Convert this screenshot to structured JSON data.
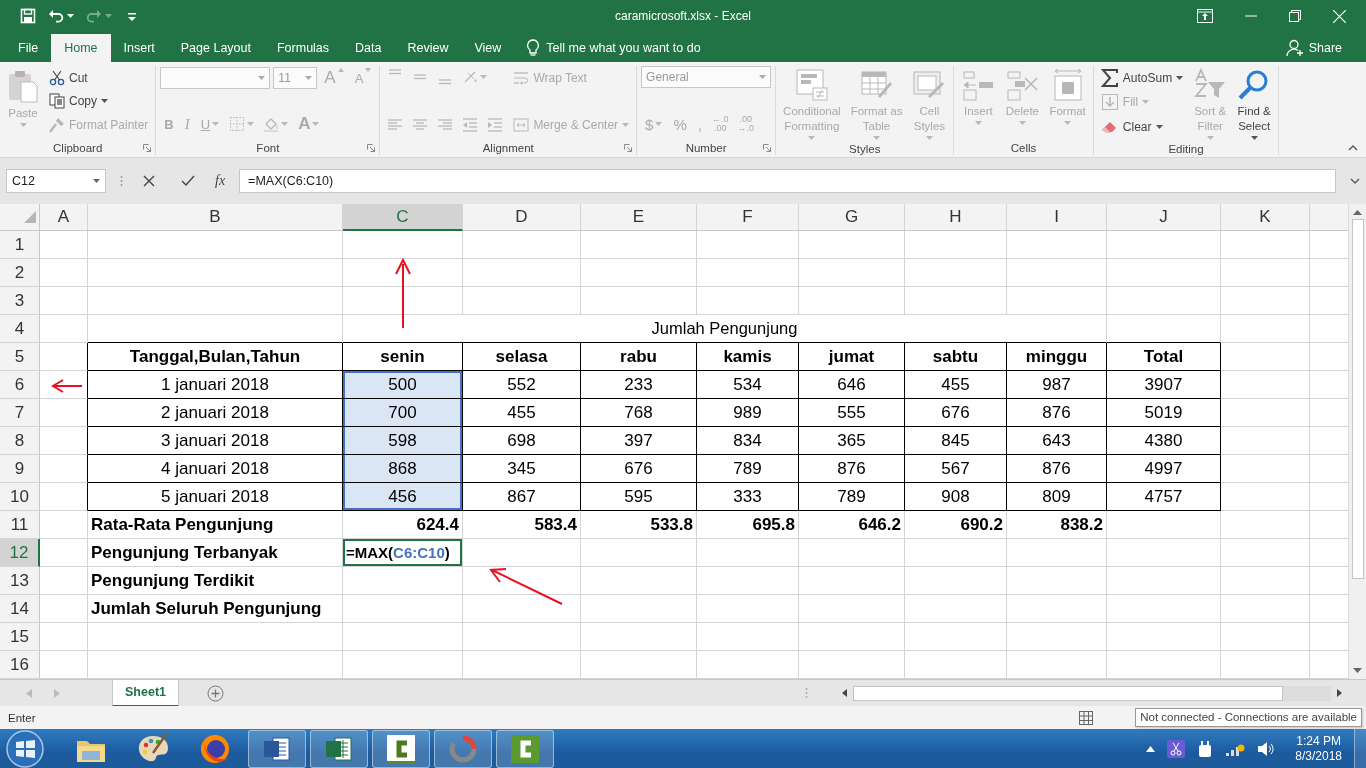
{
  "window": {
    "title": "caramicrosoft.xlsx - Excel"
  },
  "quick_access": [
    {
      "kind": "save",
      "disabled": false,
      "dropdown": false
    },
    {
      "kind": "undo",
      "disabled": false,
      "dropdown": true
    },
    {
      "kind": "redo",
      "disabled": true,
      "dropdown": true
    },
    {
      "kind": "customize",
      "disabled": false,
      "dropdown": false
    }
  ],
  "tabs": [
    {
      "label": "File",
      "selected": false
    },
    {
      "label": "Home",
      "selected": true
    },
    {
      "label": "Insert",
      "selected": false
    },
    {
      "label": "Page Layout",
      "selected": false
    },
    {
      "label": "Formulas",
      "selected": false
    },
    {
      "label": "Data",
      "selected": false
    },
    {
      "label": "Review",
      "selected": false
    },
    {
      "label": "View",
      "selected": false
    }
  ],
  "tell_me": {
    "placeholder": "Tell me what you want to do"
  },
  "share": {
    "label": "Share"
  },
  "ribbon": {
    "groups": [
      {
        "label": "Clipboard",
        "launcher": true,
        "columns": [
          [
            [
              {
                "kind": "paste",
                "label": "Paste",
                "dropdown": true,
                "disabled": true
              }
            ]
          ],
          [
            [
              {
                "kind": "cut",
                "label": "Cut",
                "dropdown": false,
                "disabled": false
              }
            ],
            [
              {
                "kind": "copy",
                "label": "Copy",
                "dropdown": true,
                "disabled": false
              }
            ],
            [
              {
                "kind": "brush",
                "label": "Format Painter",
                "dropdown": false,
                "disabled": true
              }
            ]
          ]
        ]
      },
      {
        "label": "Font",
        "launcher": true,
        "columns": [
          [
            [
              {
                "kind": "fontfield",
                "dropdown": true,
                "disabled": true
              },
              {
                "kind": "sizefield",
                "value": "11",
                "dropdown": true,
                "disabled": true
              },
              {
                "kind": "grow",
                "label": "A",
                "dropdown": false,
                "disabled": true
              },
              {
                "kind": "shrink",
                "label": "A",
                "dropdown": false,
                "disabled": true
              }
            ],
            [
              {
                "kind": "bold",
                "label": "B",
                "dropdown": false,
                "disabled": true
              },
              {
                "kind": "italic",
                "label": "I",
                "dropdown": false,
                "disabled": true
              },
              {
                "kind": "underline",
                "label": "U",
                "dropdown": true,
                "disabled": true
              },
              {
                "kind": "border",
                "dropdown": true,
                "disabled": true
              },
              {
                "kind": "fill",
                "dropdown": true,
                "disabled": true
              },
              {
                "kind": "fontcolor",
                "label": "A",
                "dropdown": true,
                "disabled": true
              }
            ]
          ]
        ]
      },
      {
        "label": "Alignment",
        "launcher": true,
        "columns": [
          [
            [
              {
                "kind": "align-top",
                "dropdown": false,
                "disabled": true
              },
              {
                "kind": "align-middle",
                "dropdown": false,
                "disabled": true
              },
              {
                "kind": "align-bottom",
                "dropdown": false,
                "disabled": true
              },
              {
                "kind": "orientation",
                "dropdown": true,
                "disabled": true
              }
            ],
            [
              {
                "kind": "align-left",
                "dropdown": false,
                "disabled": true
              },
              {
                "kind": "align-center",
                "dropdown": false,
                "disabled": true
              },
              {
                "kind": "align-right",
                "dropdown": false,
                "disabled": true
              },
              {
                "kind": "outdent",
                "dropdown": false,
                "disabled": true
              },
              {
                "kind": "indent",
                "dropdown": false,
                "disabled": true
              }
            ]
          ],
          [
            [
              {
                "kind": "wrap",
                "label": "Wrap Text",
                "dropdown": false,
                "disabled": true
              }
            ],
            [
              {
                "kind": "merge",
                "label": "Merge & Center",
                "dropdown": true,
                "disabled": true
              }
            ]
          ]
        ]
      },
      {
        "label": "Number",
        "launcher": true,
        "columns": [
          [
            [
              {
                "kind": "formatfield",
                "value": "General",
                "dropdown": true,
                "disabled": true
              }
            ],
            [
              {
                "kind": "currency",
                "label": "$",
                "dropdown": true,
                "disabled": true
              },
              {
                "kind": "glyph",
                "label": "%",
                "dropdown": false,
                "disabled": true
              },
              {
                "kind": "glyph",
                "label": ",",
                "dropdown": false,
                "disabled": true
              },
              {
                "kind": "decimal",
                "lines": [
                  "←.0",
                  ".00"
                ],
                "dropdown": false,
                "disabled": true
              },
              {
                "kind": "decimal",
                "lines": [
                  ".00",
                  "→.0"
                ],
                "dropdown": false,
                "disabled": true
              }
            ]
          ]
        ]
      },
      {
        "label": "Styles",
        "launcher": false,
        "columns": [
          [
            [
              {
                "kind": "conditional",
                "label": "Conditional\nFormatting",
                "dropdown": true,
                "disabled": true
              }
            ]
          ],
          [
            [
              {
                "kind": "table",
                "label": "Format as\nTable",
                "dropdown": true,
                "disabled": true
              }
            ]
          ],
          [
            [
              {
                "kind": "cellstyles",
                "label": "Cell\nStyles",
                "dropdown": true,
                "disabled": true
              }
            ]
          ]
        ]
      },
      {
        "label": "Cells",
        "launcher": false,
        "columns": [
          [
            [
              {
                "kind": "insertcells",
                "label": "Insert",
                "dropdown": true,
                "disabled": true
              }
            ]
          ],
          [
            [
              {
                "kind": "deletecells",
                "label": "Delete",
                "dropdown": true,
                "disabled": true
              }
            ]
          ],
          [
            [
              {
                "kind": "formatcells",
                "label": "Format",
                "dropdown": true,
                "disabled": true
              }
            ]
          ]
        ]
      },
      {
        "label": "Editing",
        "launcher": false,
        "columns": [
          [
            [
              {
                "kind": "autosum",
                "label": "AutoSum",
                "dropdown": true,
                "disabled": false
              }
            ],
            [
              {
                "kind": "filldown",
                "label": "Fill",
                "dropdown": true,
                "disabled": true
              }
            ],
            [
              {
                "kind": "eraser",
                "label": "Clear",
                "dropdown": true,
                "disabled": false
              }
            ]
          ],
          [
            [
              {
                "kind": "sort",
                "label": "Sort &\nFilter",
                "dropdown": true,
                "disabled": true
              }
            ]
          ],
          [
            [
              {
                "kind": "find",
                "label": "Find &\nSelect",
                "dropdown": true,
                "disabled": false
              }
            ]
          ]
        ]
      }
    ]
  },
  "formula_bar": {
    "name_box": "C12",
    "function_label": "fx",
    "formula": "=MAX(C6:C10)"
  },
  "sheet": {
    "columns": [
      {
        "label": "A",
        "selected": false
      },
      {
        "label": "B",
        "selected": false
      },
      {
        "label": "C",
        "selected": true
      },
      {
        "label": "D",
        "selected": false
      },
      {
        "label": "E",
        "selected": false
      },
      {
        "label": "F",
        "selected": false
      },
      {
        "label": "G",
        "selected": false
      },
      {
        "label": "H",
        "selected": false
      },
      {
        "label": "I",
        "selected": false
      },
      {
        "label": "J",
        "selected": false
      },
      {
        "label": "K",
        "selected": false
      }
    ],
    "rows": [
      {
        "number": "1",
        "selected": false,
        "kind": "blank"
      },
      {
        "number": "2",
        "selected": false,
        "kind": "blank"
      },
      {
        "number": "3",
        "selected": false,
        "kind": "blank"
      },
      {
        "number": "4",
        "selected": false,
        "kind": "title",
        "cells": [
          {
            "text": "Jumlah Pengunjung"
          }
        ]
      },
      {
        "number": "5",
        "selected": false,
        "kind": "header",
        "cells": [
          {
            "text": "Tanggal,Bulan,Tahun"
          },
          {
            "text": "senin"
          },
          {
            "text": "selasa"
          },
          {
            "text": "rabu"
          },
          {
            "text": "kamis"
          },
          {
            "text": "jumat"
          },
          {
            "text": "sabtu"
          },
          {
            "text": "minggu"
          },
          {
            "text": "Total"
          }
        ]
      },
      {
        "number": "6",
        "selected": false,
        "kind": "data",
        "cells": [
          {
            "text": "1 januari 2018",
            "highlighted": false
          },
          {
            "text": "500",
            "highlighted": true
          },
          {
            "text": "552",
            "highlighted": false
          },
          {
            "text": "233",
            "highlighted": false
          },
          {
            "text": "534",
            "highlighted": false
          },
          {
            "text": "646",
            "highlighted": false
          },
          {
            "text": "455",
            "highlighted": false
          },
          {
            "text": "987",
            "highlighted": false
          },
          {
            "text": "3907",
            "highlighted": false
          }
        ]
      },
      {
        "number": "7",
        "selected": false,
        "kind": "data",
        "cells": [
          {
            "text": "2 januari 2018",
            "highlighted": false
          },
          {
            "text": "700",
            "highlighted": true
          },
          {
            "text": "455",
            "highlighted": false
          },
          {
            "text": "768",
            "highlighted": false
          },
          {
            "text": "989",
            "highlighted": false
          },
          {
            "text": "555",
            "highlighted": false
          },
          {
            "text": "676",
            "highlighted": false
          },
          {
            "text": "876",
            "highlighted": false
          },
          {
            "text": "5019",
            "highlighted": false
          }
        ]
      },
      {
        "number": "8",
        "selected": false,
        "kind": "data",
        "cells": [
          {
            "text": "3 januari 2018",
            "highlighted": false
          },
          {
            "text": "598",
            "highlighted": true
          },
          {
            "text": "698",
            "highlighted": false
          },
          {
            "text": "397",
            "highlighted": false
          },
          {
            "text": "834",
            "highlighted": false
          },
          {
            "text": "365",
            "highlighted": false
          },
          {
            "text": "845",
            "highlighted": false
          },
          {
            "text": "643",
            "highlighted": false
          },
          {
            "text": "4380",
            "highlighted": false
          }
        ]
      },
      {
        "number": "9",
        "selected": false,
        "kind": "data",
        "cells": [
          {
            "text": "4 januari 2018",
            "highlighted": false
          },
          {
            "text": "868",
            "highlighted": true
          },
          {
            "text": "345",
            "highlighted": false
          },
          {
            "text": "676",
            "highlighted": false
          },
          {
            "text": "789",
            "highlighted": false
          },
          {
            "text": "876",
            "highlighted": false
          },
          {
            "text": "567",
            "highlighted": false
          },
          {
            "text": "876",
            "highlighted": false
          },
          {
            "text": "4997",
            "highlighted": false
          }
        ]
      },
      {
        "number": "10",
        "selected": false,
        "kind": "data",
        "cells": [
          {
            "text": "5 januari 2018",
            "highlighted": false
          },
          {
            "text": "456",
            "highlighted": true
          },
          {
            "text": "867",
            "highlighted": false
          },
          {
            "text": "595",
            "highlighted": false
          },
          {
            "text": "333",
            "highlighted": false
          },
          {
            "text": "789",
            "highlighted": false
          },
          {
            "text": "908",
            "highlighted": false
          },
          {
            "text": "809",
            "highlighted": false
          },
          {
            "text": "4757",
            "highlighted": false
          }
        ]
      },
      {
        "number": "11",
        "selected": false,
        "kind": "summary",
        "cells": [
          {
            "text": "Rata-Rata Pengunjung"
          },
          {
            "text": "624.4"
          },
          {
            "text": "583.4"
          },
          {
            "text": "533.8"
          },
          {
            "text": "695.8"
          },
          {
            "text": "646.2"
          },
          {
            "text": "690.2"
          },
          {
            "text": "838.2"
          }
        ]
      },
      {
        "number": "12",
        "selected": true,
        "kind": "label",
        "cells": [
          {
            "kind": "text",
            "text": "Pengunjung Terbanyak"
          },
          {
            "kind": "editing",
            "segments": [
              {
                "kind": "plain",
                "text": "=MAX("
              },
              {
                "kind": "reference",
                "text": "C6:C10"
              },
              {
                "kind": "plain",
                "text": ")"
              }
            ]
          }
        ]
      },
      {
        "number": "13",
        "selected": false,
        "kind": "label",
        "cells": [
          {
            "kind": "text",
            "text": "Pengunjung Terdikit"
          }
        ]
      },
      {
        "number": "14",
        "selected": false,
        "kind": "label",
        "cells": [
          {
            "kind": "text",
            "text": "Jumlah Seluruh Pengunjung"
          }
        ]
      },
      {
        "number": "15",
        "selected": false,
        "kind": "blank"
      },
      {
        "number": "16",
        "selected": false,
        "kind": "blank"
      }
    ]
  },
  "annotations": [
    {
      "kind": "uparrow"
    },
    {
      "kind": "leftarrow"
    },
    {
      "kind": "diagonalarrow"
    }
  ],
  "sheet_tabs": [
    {
      "label": "Sheet1",
      "selected": true
    }
  ],
  "status_bar": {
    "mode": "Enter",
    "tooltip": "Not connected - Connections are available"
  },
  "taskbar": {
    "apps": [
      {
        "kind": "folder",
        "running": false
      },
      {
        "kind": "palette",
        "running": false
      },
      {
        "kind": "browser",
        "running": false
      },
      {
        "kind": "word",
        "running": true
      },
      {
        "kind": "excel",
        "running": true
      },
      {
        "kind": "recorder",
        "running": true
      },
      {
        "kind": "ring",
        "running": true
      },
      {
        "kind": "recorder2",
        "running": true
      }
    ],
    "clock": {
      "time": "1:24 PM",
      "date": "8/3/2018"
    }
  }
}
